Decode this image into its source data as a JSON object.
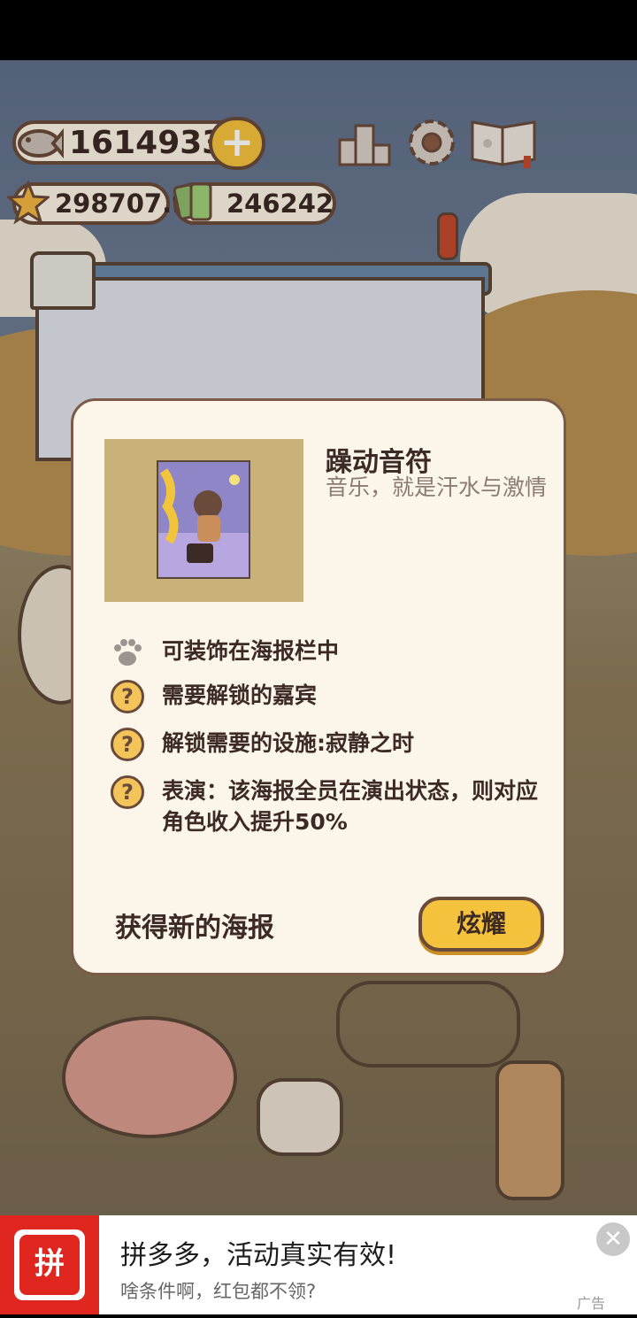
{
  "hud": {
    "fish_count": "16149333",
    "star_count": "298707.9",
    "ticket_count": "246242",
    "plus_label": "+"
  },
  "modal": {
    "title": "躁动音符",
    "subtitle": "音乐，就是汗水与激情",
    "features": [
      {
        "icon": "paw-icon",
        "text": "可装饰在海报栏中"
      },
      {
        "icon": "question-icon",
        "text": "需要解锁的嘉宾"
      },
      {
        "icon": "question-icon",
        "text": "解锁需要的设施:寂静之时"
      },
      {
        "icon": "question-icon",
        "text": "表演：该海报全员在演出状态，则对应角色收入提升50%"
      }
    ],
    "new_poster_label": "获得新的海报",
    "show_button": "炫耀",
    "question_mark": "?"
  },
  "ad": {
    "logo_text": "拼",
    "title": "拼多多，活动真实有效!",
    "subtitle": "啥条件啊，红包都不领?",
    "tag": "广告",
    "close": "✕"
  },
  "colors": {
    "accent_yellow": "#f5c23d",
    "panel_bg": "#fcf5e9",
    "outline_brown": "#6a4a3a",
    "ad_red": "#e0271f"
  }
}
